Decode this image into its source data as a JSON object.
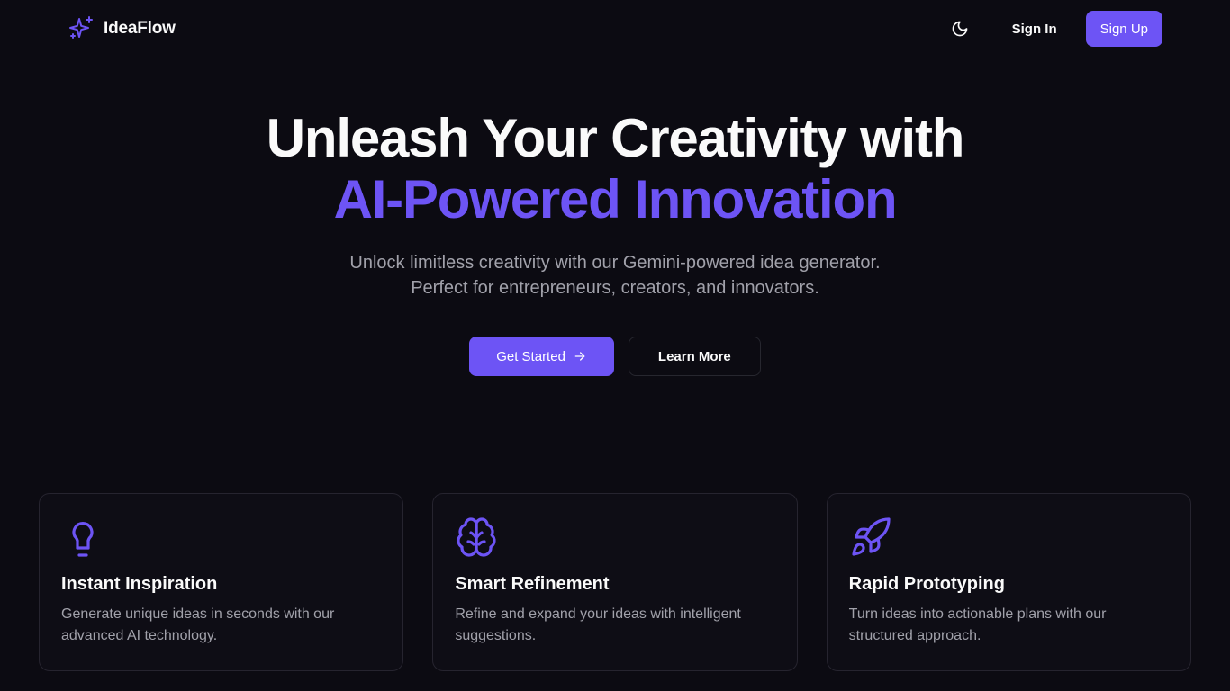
{
  "header": {
    "brand_name": "IdeaFlow",
    "sign_in_label": "Sign In",
    "sign_up_label": "Sign Up"
  },
  "hero": {
    "title_line1": "Unleash Your Creativity with",
    "title_line2": "AI-Powered Innovation",
    "subtitle_line1": "Unlock limitless creativity with our Gemini-powered idea generator.",
    "subtitle_line2": "Perfect for entrepreneurs, creators, and innovators.",
    "primary_cta": "Get Started",
    "secondary_cta": "Learn More"
  },
  "features": [
    {
      "icon": "lightbulb-icon",
      "title": "Instant Inspiration",
      "description": "Generate unique ideas in seconds with our advanced AI technology."
    },
    {
      "icon": "brain-icon",
      "title": "Smart Refinement",
      "description": "Refine and expand your ideas with intelligent suggestions."
    },
    {
      "icon": "rocket-icon",
      "title": "Rapid Prototyping",
      "description": "Turn ideas into actionable plans with our structured approach."
    }
  ],
  "icons": {
    "brand": "sparkles-icon",
    "theme_toggle": "moon-icon",
    "cta_arrow": "arrow-right-icon"
  },
  "colors": {
    "accent": "#6d54f5",
    "background": "#0c0b12",
    "muted_text": "#a1a1aa",
    "border": "#26242f"
  }
}
